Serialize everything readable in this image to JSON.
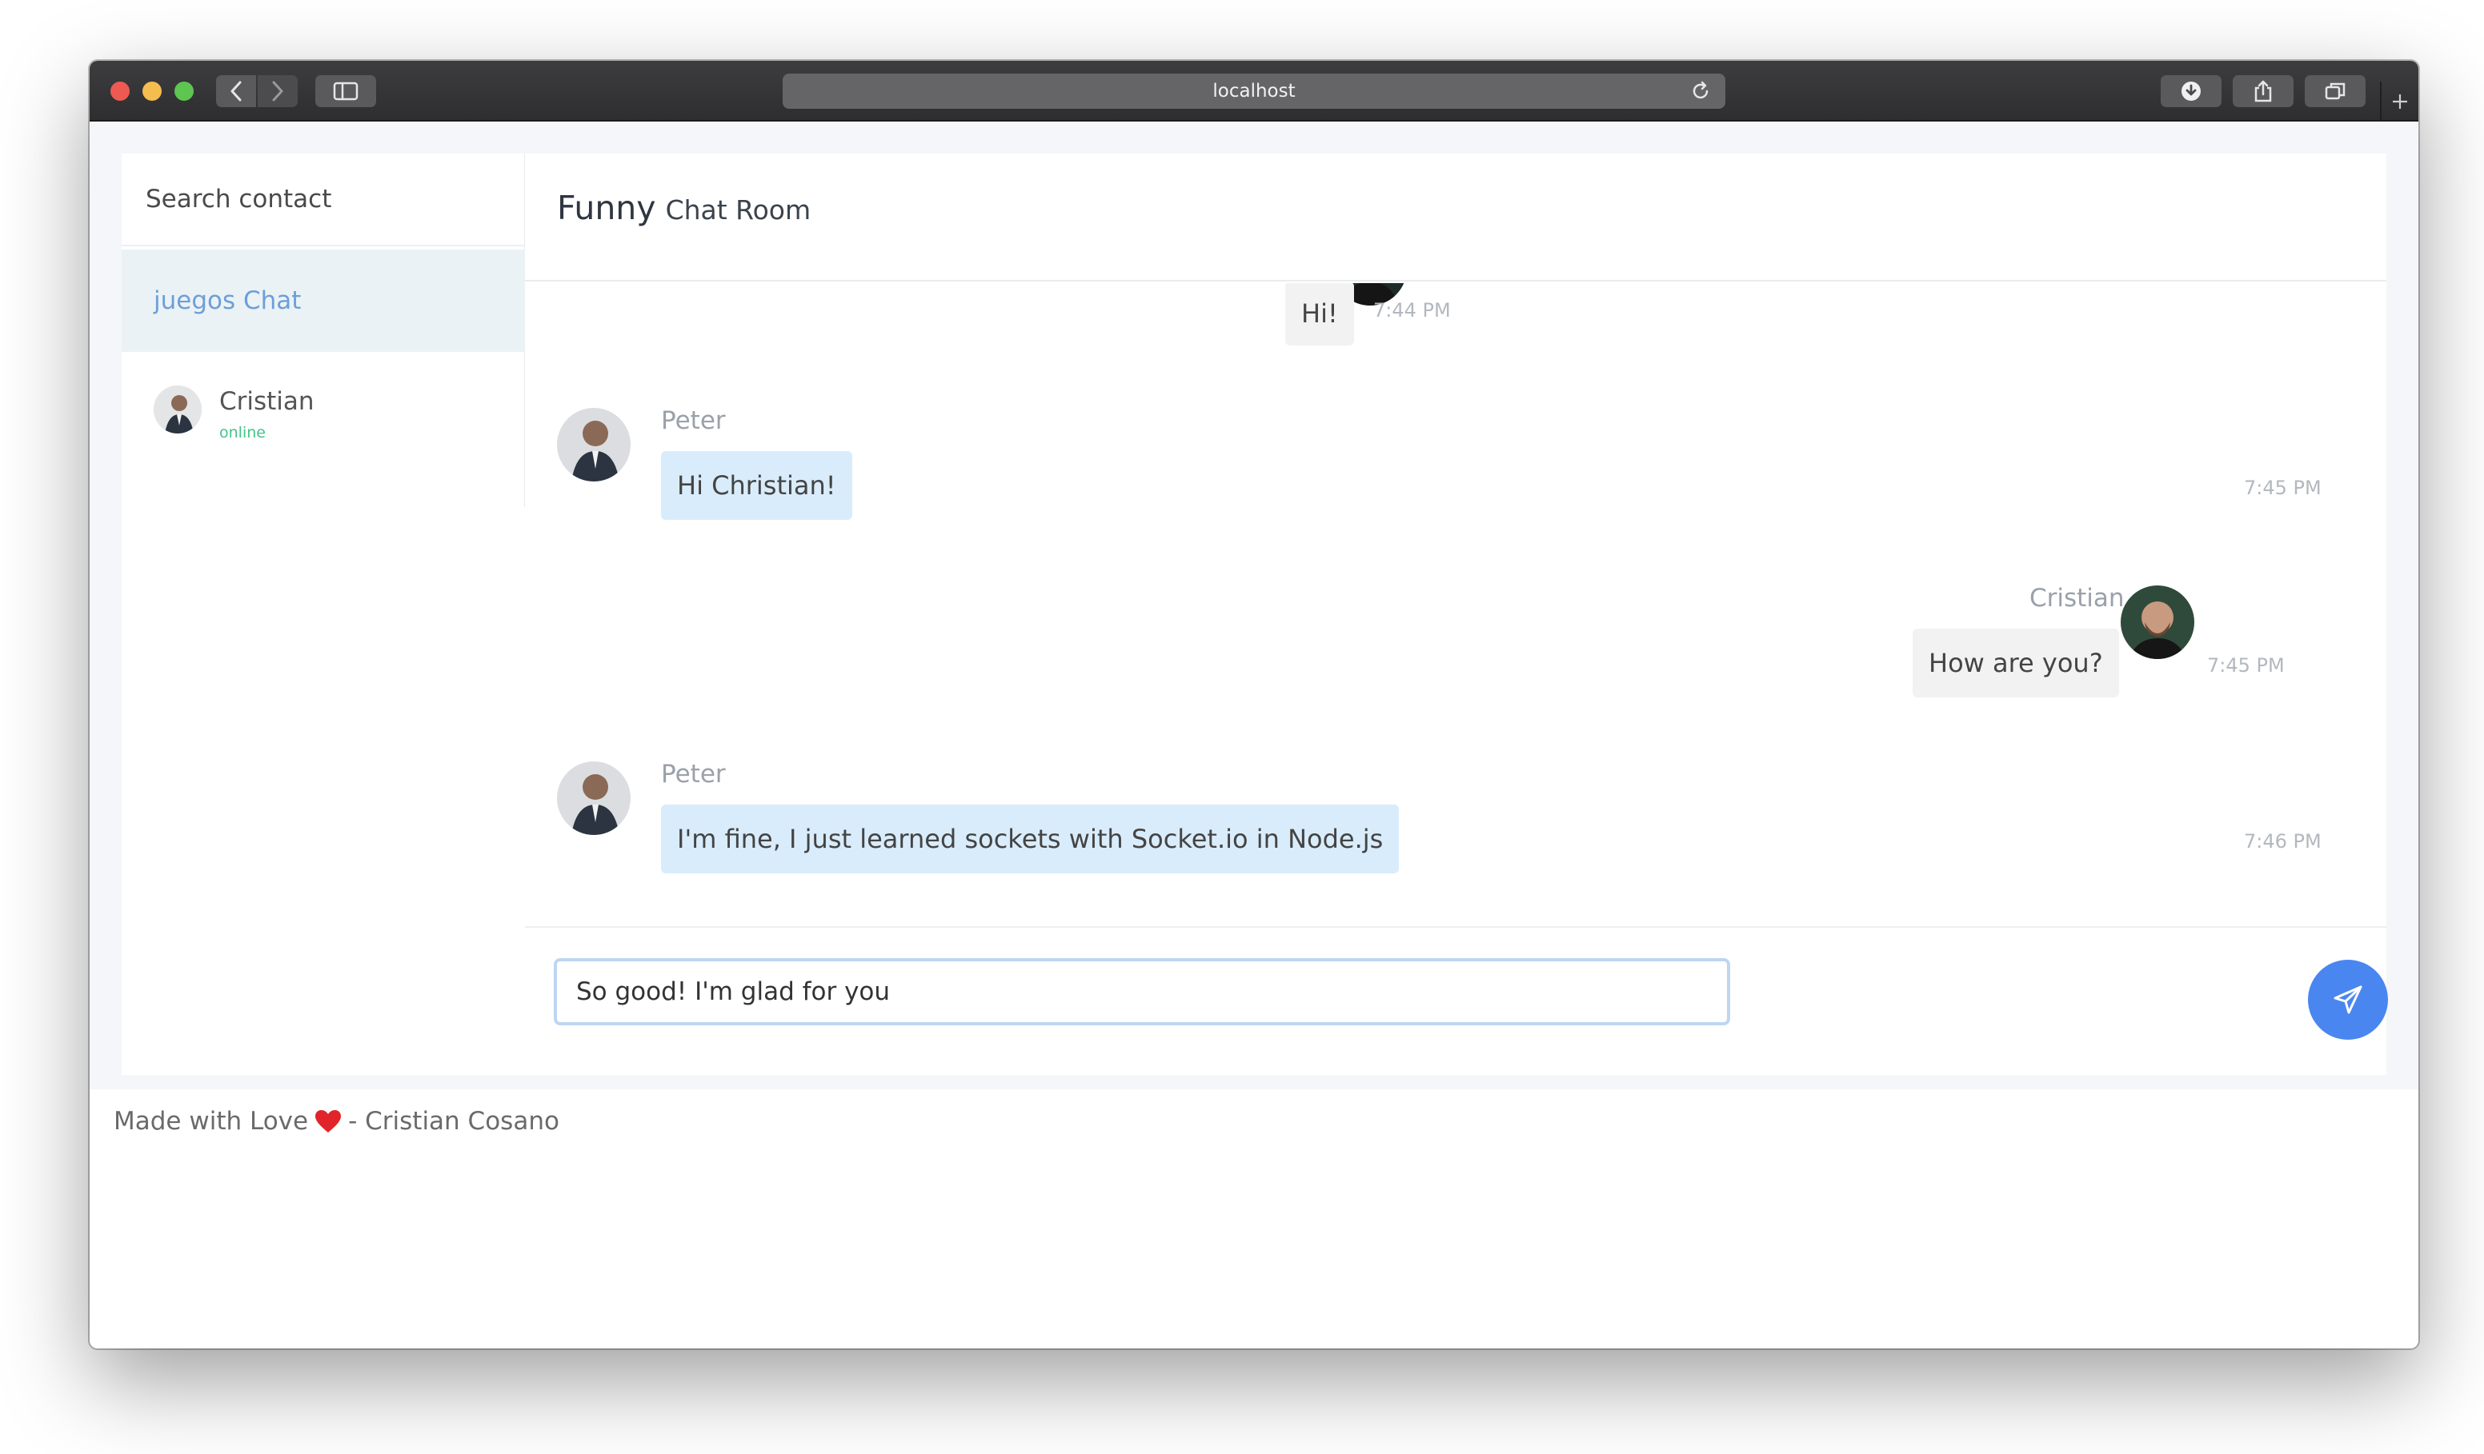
{
  "browser": {
    "address": "localhost"
  },
  "sidebar": {
    "search_placeholder": "Search contact",
    "group_chat": "juegos Chat",
    "contacts": [
      {
        "name": "Cristian",
        "status": "online"
      }
    ]
  },
  "chat": {
    "title": "Funny",
    "subtitle": "Chat Room",
    "messages": [
      {
        "sender": "",
        "text": "Hi!",
        "time": "7:44 PM",
        "direction": "out"
      },
      {
        "sender": "Peter",
        "text": "Hi Christian!",
        "time": "7:45 PM",
        "direction": "in"
      },
      {
        "sender": "Cristian",
        "text": "How are you?",
        "time": "7:45 PM",
        "direction": "out"
      },
      {
        "sender": "Peter",
        "text": "I'm fine, I just learned sockets with Socket.io in Node.js",
        "time": "7:46 PM",
        "direction": "in"
      }
    ],
    "composer_value": "So good! I'm glad for you"
  },
  "footer": {
    "made_with": "Made with Love",
    "author": "- Cristian Cosano"
  },
  "colors": {
    "accent": "#4a86f0",
    "incoming_bubble": "#d9ecfb",
    "outgoing_bubble": "#f2f2f2",
    "online": "#45c38a",
    "group_chat_text": "#6d9fd8",
    "heart": "#e0242a"
  }
}
